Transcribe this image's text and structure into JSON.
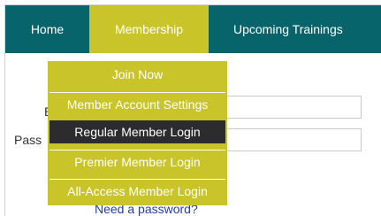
{
  "nav": {
    "items": [
      {
        "label": "Home"
      },
      {
        "label": "Membership"
      },
      {
        "label": "Upcoming Trainings"
      }
    ],
    "active_item": "Membership",
    "colors": {
      "bar": "#07646b",
      "active": "#c8c429"
    }
  },
  "dropdown": {
    "items": [
      {
        "label": "Join Now"
      },
      {
        "label": "Member Account Settings"
      },
      {
        "label": "Regular Member Login"
      },
      {
        "label": "Premier Member Login"
      },
      {
        "label": "All-Access Member Login"
      }
    ],
    "hovered_item": "Regular Member Login",
    "colors": {
      "background": "#c8c429",
      "hover": "#2c2c2e"
    }
  },
  "form": {
    "email_label_fragment": "E",
    "password_label_fragment": "Pass",
    "forgot_password_link": "Need a password?"
  }
}
